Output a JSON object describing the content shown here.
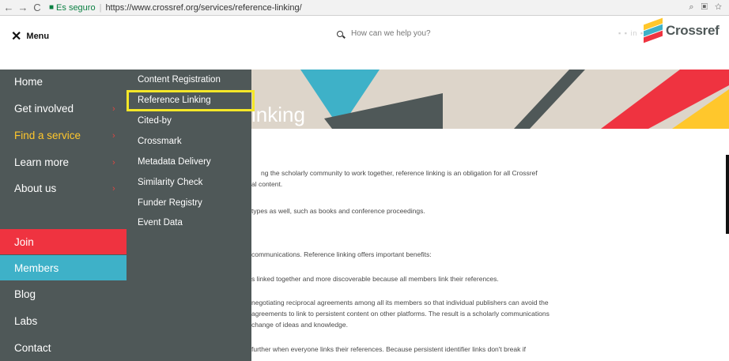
{
  "browser": {
    "nav_icons": [
      "back-arrow-icon",
      "forward-arrow-icon",
      "reload-icon"
    ],
    "secure_label": "Es seguro",
    "url_scheme": "https://",
    "url_rest": "www.crossref.org/services/reference-linking/"
  },
  "header": {
    "menu_label": "Menu",
    "search_placeholder": "How can we help you?",
    "logo_text": "Crossref"
  },
  "banner": {
    "title": "inking"
  },
  "sidebar": {
    "items": [
      {
        "label": "Home"
      },
      {
        "label": "Get involved",
        "chevron": "›"
      },
      {
        "label": "Find a service",
        "chevron": "›"
      },
      {
        "label": "Learn more",
        "chevron": "›"
      },
      {
        "label": "About us",
        "chevron": "›"
      }
    ],
    "join": "Join",
    "members": "Members",
    "blog": "Blog",
    "labs": "Labs",
    "contact": "Contact"
  },
  "submenu": {
    "items": [
      {
        "label": "Content Registration"
      },
      {
        "label": "Reference Linking"
      },
      {
        "label": "Cited-by"
      },
      {
        "label": "Crossmark"
      },
      {
        "label": "Metadata Delivery"
      },
      {
        "label": "Similarity Check"
      },
      {
        "label": "Funder Registry"
      },
      {
        "label": "Event Data"
      }
    ]
  },
  "content": {
    "p1a": "ng the scholarly community to work together, reference linking is an obligation for all Crossref",
    "p1b": "al content.",
    "p2": "types as well, such as books and conference proceedings.",
    "p3": "communications. Reference linking offers important benefits:",
    "p4": "s linked together and more discoverable because all members link their references.",
    "p5a": "negotiating reciprocal agreements among all its members so that individual publishers can avoid the",
    "p5b": "agreements to link to persistent content on other platforms. The result is a scholarly communications",
    "p5c": "change of ideas and knowledge.",
    "p6": "further when everyone links their references. Because persistent identifier links don't break if"
  },
  "colors": {
    "sidebar_bg": "#4f5858",
    "active": "#ffc72c",
    "join": "#ef3340",
    "members": "#3eb1c8",
    "highlight": "#f4e728"
  }
}
